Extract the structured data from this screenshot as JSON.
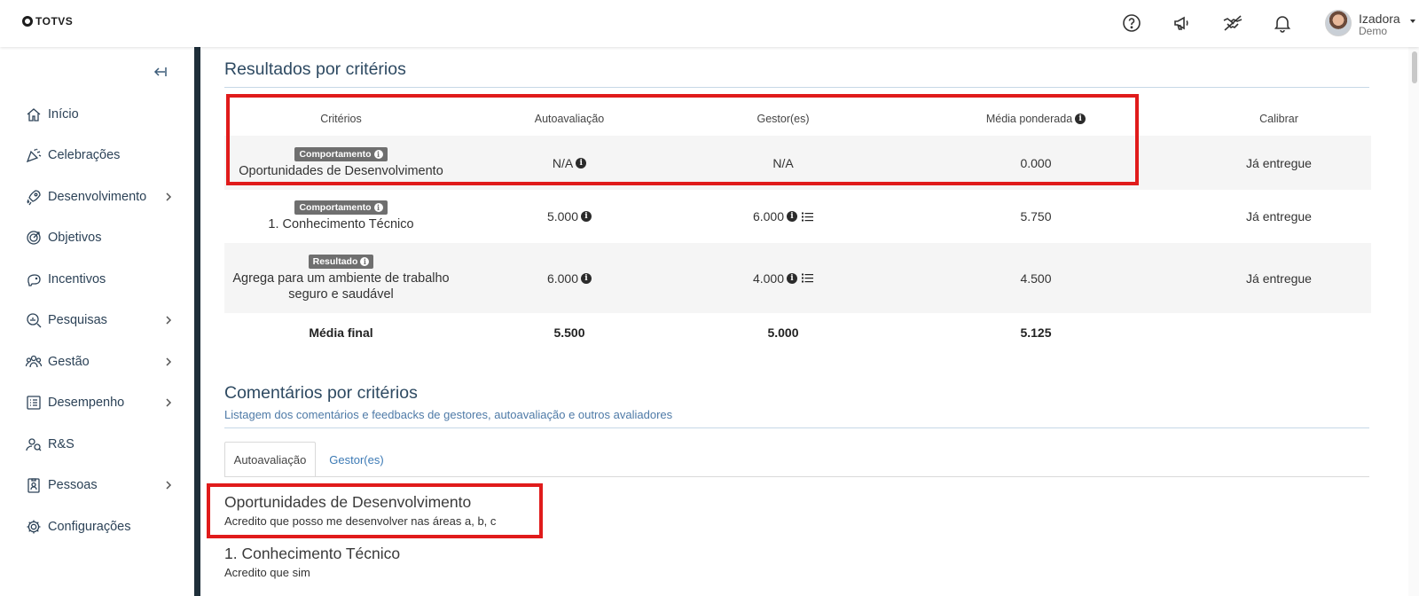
{
  "header": {
    "logo_text": "TOTVS",
    "user_name": "Izadora",
    "user_role": "Demo",
    "icons": [
      "help-icon",
      "megaphone-icon",
      "handshake-icon",
      "bell-icon"
    ]
  },
  "sidebar": {
    "items": [
      {
        "label": "Início",
        "icon": "home-icon",
        "chevron": false
      },
      {
        "label": "Celebrações",
        "icon": "party-icon",
        "chevron": false
      },
      {
        "label": "Desenvolvimento",
        "icon": "rocket-icon",
        "chevron": true
      },
      {
        "label": "Objetivos",
        "icon": "target-icon",
        "chevron": false
      },
      {
        "label": "Incentivos",
        "icon": "piggy-bank-icon",
        "chevron": false
      },
      {
        "label": "Pesquisas",
        "icon": "search-chart-icon",
        "chevron": true
      },
      {
        "label": "Gestão",
        "icon": "team-icon",
        "chevron": true
      },
      {
        "label": "Desempenho",
        "icon": "checklist-icon",
        "chevron": true
      },
      {
        "label": "R&S",
        "icon": "recruit-icon",
        "chevron": false
      },
      {
        "label": "Pessoas",
        "icon": "badge-icon",
        "chevron": true
      },
      {
        "label": "Configurações",
        "icon": "gear-icon",
        "chevron": false
      }
    ]
  },
  "results": {
    "title": "Resultados por critérios",
    "columns": [
      "Critérios",
      "Autoavaliação",
      "Gestor(es)",
      "Média ponderada",
      "Calibrar"
    ],
    "rows": [
      {
        "badge": "Comportamento",
        "name_lines": [
          "Oportunidades de Desenvolvimento"
        ],
        "self": "N/A",
        "self_info": true,
        "manager": "N/A",
        "manager_info": false,
        "manager_list": false,
        "weighted": "0.000",
        "calibrate": "Já entregue"
      },
      {
        "badge": "Comportamento",
        "name_lines": [
          "1. Conhecimento Técnico"
        ],
        "self": "5.000",
        "self_info": true,
        "manager": "6.000",
        "manager_info": true,
        "manager_list": true,
        "weighted": "5.750",
        "calibrate": "Já entregue"
      },
      {
        "badge": "Resultado",
        "name_lines": [
          "Agrega para um ambiente de trabalho",
          "seguro e saudável"
        ],
        "self": "6.000",
        "self_info": true,
        "manager": "4.000",
        "manager_info": true,
        "manager_list": true,
        "weighted": "4.500",
        "calibrate": "Já entregue"
      }
    ],
    "final": {
      "label": "Média final",
      "self": "5.500",
      "manager": "5.000",
      "weighted": "5.125"
    }
  },
  "comments": {
    "title": "Comentários por critérios",
    "subtitle": "Listagem dos comentários e feedbacks de gestores, autoavaliação e outros avaliadores",
    "tabs": [
      {
        "label": "Autoavaliação",
        "active": true
      },
      {
        "label": "Gestor(es)",
        "active": false
      }
    ],
    "entries": [
      {
        "title": "Oportunidades de Desenvolvimento",
        "text": "Acredito que posso me desenvolver nas áreas a, b, c"
      },
      {
        "title": "1. Conhecimento Técnico",
        "text": "Acredito que sim"
      }
    ]
  },
  "colors": {
    "highlight": "#e01b1b",
    "link": "#3c7ab5",
    "title": "#2e4a62",
    "badge": "#6f6f6f"
  }
}
